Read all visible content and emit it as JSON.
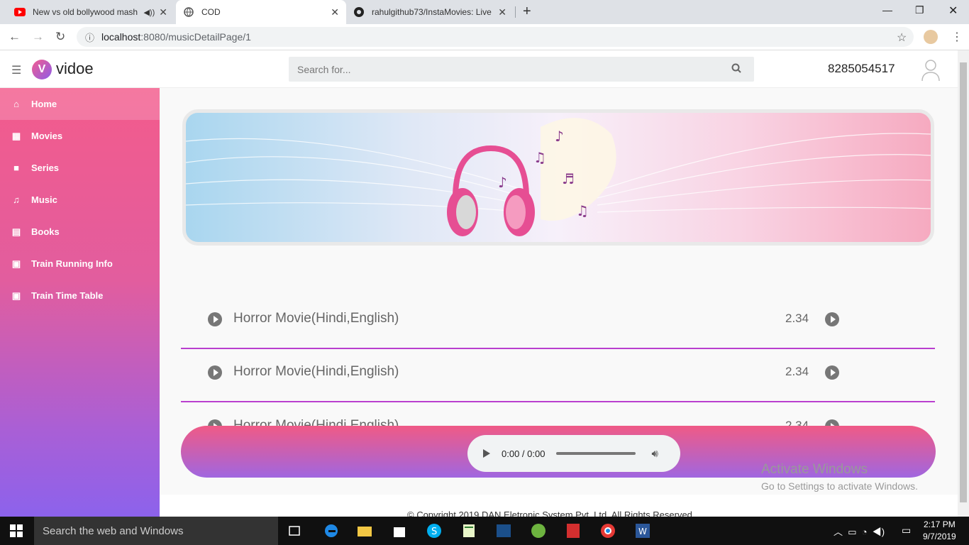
{
  "browser": {
    "tabs": [
      {
        "title": "New vs old bollywood mash",
        "icon": "youtube-icon"
      },
      {
        "title": "COD",
        "icon": "globe-icon"
      },
      {
        "title": "rahulgithub73/InstaMovies: Live",
        "icon": "github-icon"
      }
    ],
    "url_host": "localhost",
    "url_path": ":8080/musicDetailPage/1"
  },
  "app": {
    "logo_letter": "V",
    "logo_text": "vidoe",
    "search_placeholder": "Search for...",
    "phone": "8285054517"
  },
  "sidebar": {
    "items": [
      {
        "label": "Home",
        "icon": "home-icon",
        "glyph": "⌂"
      },
      {
        "label": "Movies",
        "icon": "film-icon",
        "glyph": "▦"
      },
      {
        "label": "Series",
        "icon": "video-camera-icon",
        "glyph": "■"
      },
      {
        "label": "Music",
        "icon": "music-note-icon",
        "glyph": "♫"
      },
      {
        "label": "Books",
        "icon": "book-icon",
        "glyph": "▤"
      },
      {
        "label": "Train Running Info",
        "icon": "train-icon",
        "glyph": "▣"
      },
      {
        "label": "Train Time Table",
        "icon": "subway-icon",
        "glyph": "▣"
      }
    ]
  },
  "tracks": [
    {
      "title": "Horror Movie(Hindi,English)",
      "duration": "2.34"
    },
    {
      "title": "Horror Movie(Hindi,English)",
      "duration": "2.34"
    },
    {
      "title": "Horror Movie(Hindi,English)",
      "duration": "2.34"
    }
  ],
  "player": {
    "time": "0:00 / 0:00"
  },
  "footer": {
    "copyright": "© Copyright 2019 DAN Eletronic System Pvt. Ltd. All Rights Reserved"
  },
  "watermark": {
    "line1": "Activate Windows",
    "line2": "Go to Settings to activate Windows."
  },
  "taskbar": {
    "search_placeholder": "Search the web and Windows",
    "time": "2:17 PM",
    "date": "9/7/2019"
  },
  "colors": {
    "accent_pink": "#f35b8c",
    "accent_purple": "#8c62ec",
    "track_divider": "#b93fcf"
  }
}
